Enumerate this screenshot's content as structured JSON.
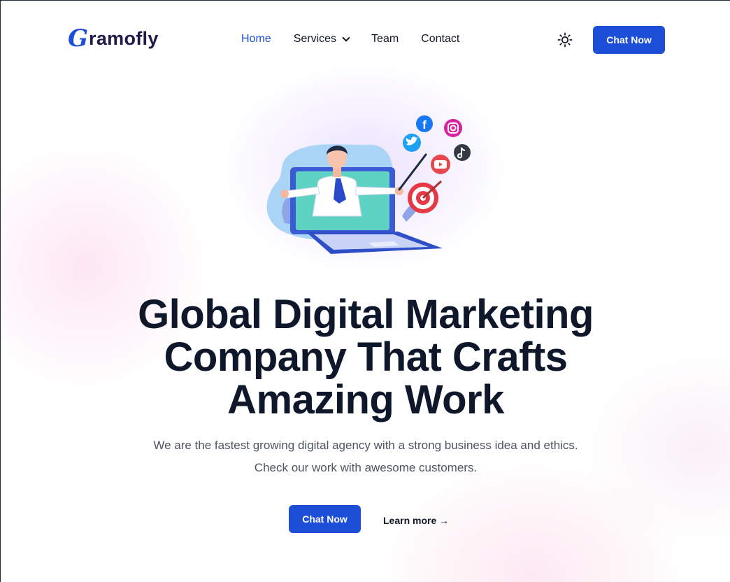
{
  "brand": {
    "mark": "G",
    "name": "ramofly",
    "color": "#1d4ed8"
  },
  "nav": {
    "items": [
      {
        "label": "Home",
        "active": true
      },
      {
        "label": "Services",
        "has_dropdown": true
      },
      {
        "label": "Team"
      },
      {
        "label": "Contact"
      }
    ]
  },
  "header": {
    "theme_icon": "sun-icon",
    "cta_label": "Chat Now"
  },
  "hero": {
    "illustration": "person-in-laptop-with-social-media-icons",
    "title_lines": [
      "Global Digital Marketing",
      "Company That Crafts",
      "Amazing Work"
    ],
    "subtitle_lines": [
      "We are the fastest growing digital agency with a strong business idea and ethics.",
      "Check our work with awesome customers."
    ],
    "cta_label": "Chat Now",
    "learn_more_label": "Learn more →"
  },
  "colors": {
    "primary": "#1d4ed8",
    "heading": "#0f172a",
    "body_text": "#4b5563"
  }
}
